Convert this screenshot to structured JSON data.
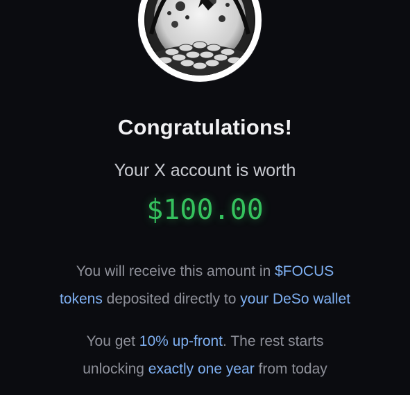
{
  "heading": "Congratulations!",
  "subtitle": "Your X account is worth",
  "amount": "$100.00",
  "receive": {
    "line1_pre": "You will receive this amount in ",
    "line1_hl": "$FOCUS",
    "line2_hl1": "tokens",
    "line2_mid": " deposited directly to ",
    "line2_hl2": "your DeSo wallet"
  },
  "unlock": {
    "line1_pre": "You get ",
    "line1_hl": "10% up-front",
    "line1_post": ". The rest starts",
    "line2_pre": "unlocking ",
    "line2_hl": "exactly one year",
    "line2_post": " from today"
  },
  "colors": {
    "background": "#0b0c10",
    "amount_green": "#35c25e",
    "highlight_blue": "#7fb0f2",
    "muted_text": "#8e9099"
  },
  "icons": {
    "avatar": "coin-pile-moon-illustration"
  }
}
